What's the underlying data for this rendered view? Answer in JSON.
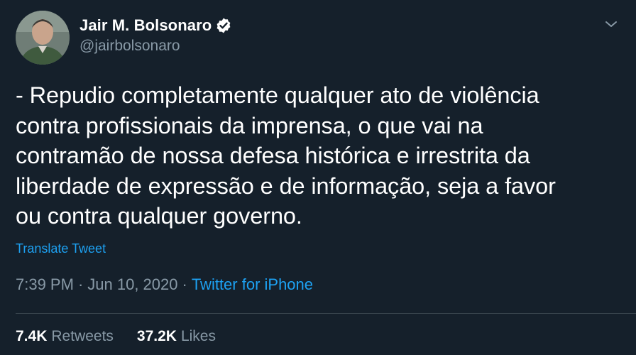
{
  "author": {
    "display_name": "Jair M. Bolsonaro",
    "handle": "@jairbolsonaro",
    "verified": true
  },
  "tweet": {
    "lines": [
      "- Repudio completamente qualquer ato de violência",
      "contra profissionais da imprensa, o que vai na",
      "contramão de nossa defesa histórica e irrestrita da",
      "liberdade de expressão e de informação, seja a favor",
      "ou contra qualquer governo."
    ],
    "translate_label": "Translate Tweet",
    "time": "7:39 PM",
    "separator": "·",
    "date": "Jun 10, 2020",
    "source": "Twitter for iPhone"
  },
  "stats": {
    "retweets_count": "7.4K",
    "retweets_label": "Retweets",
    "likes_count": "37.2K",
    "likes_label": "Likes"
  },
  "icons": {
    "verified_badge": "verified-badge-icon",
    "menu_caret": "chevron-down-icon"
  },
  "colors": {
    "background": "#15202b",
    "link": "#1da1f2",
    "secondary_text": "#8899a6",
    "divider": "#38444d"
  }
}
